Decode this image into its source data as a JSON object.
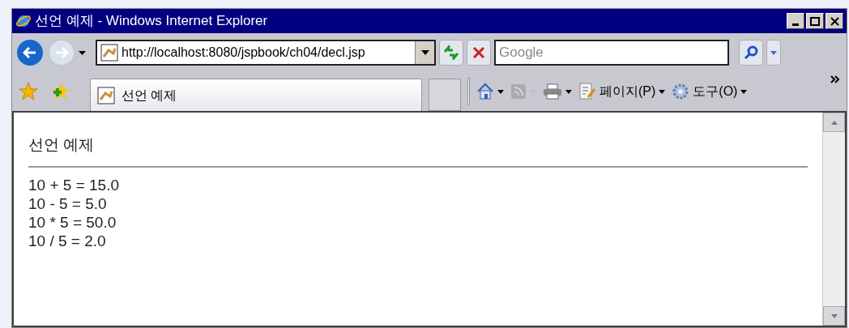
{
  "window": {
    "title": "선언 예제 - Windows Internet Explorer"
  },
  "address_bar": {
    "url": "http://localhost:8080/jspbook/ch04/decl.jsp"
  },
  "search": {
    "placeholder": "Google"
  },
  "tabs": [
    {
      "label": "선언 예제",
      "selected": true
    }
  ],
  "command_bar": [
    {
      "kind": "home",
      "disabled": false
    },
    {
      "kind": "feeds",
      "disabled": true
    },
    {
      "kind": "print",
      "disabled": false
    },
    {
      "kind": "page",
      "label": "페이지(P)",
      "disabled": false
    },
    {
      "kind": "tools",
      "label": "도구(O)",
      "disabled": false
    }
  ],
  "page": {
    "heading": "선언 예제",
    "lines": [
      "10 + 5 = 15.0",
      "10 - 5 = 5.0",
      "10 * 5 = 50.0",
      "10 / 5 = 2.0"
    ]
  }
}
